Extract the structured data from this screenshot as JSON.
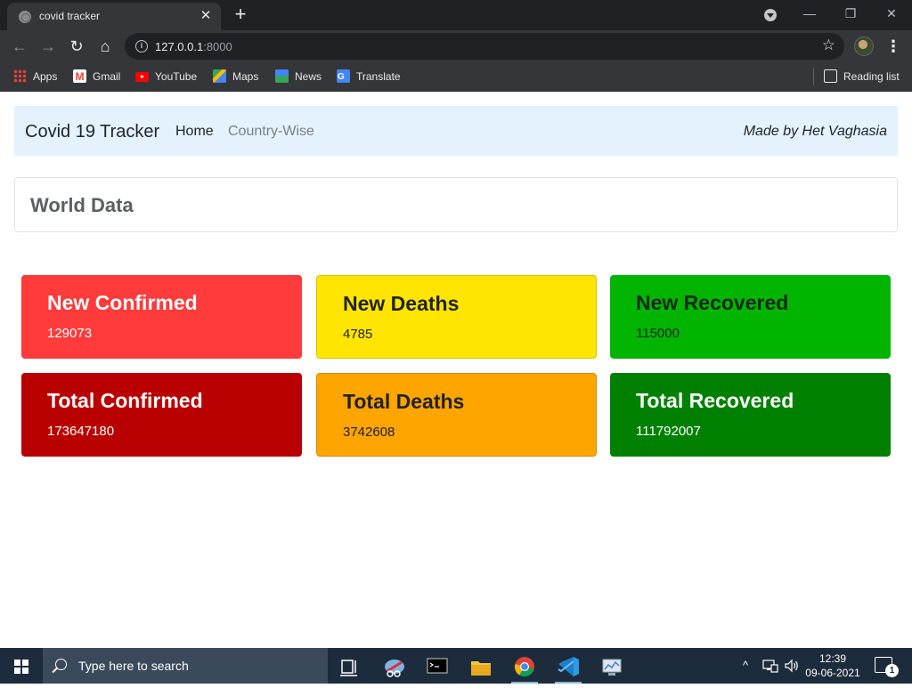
{
  "browser": {
    "tab_title": "covid tracker",
    "url_host": "127.0.0.1",
    "url_port": ":8000",
    "bookmarks": [
      {
        "label": "Apps",
        "icon": "apps-grid-icon"
      },
      {
        "label": "Gmail",
        "icon": "gmail-icon"
      },
      {
        "label": "YouTube",
        "icon": "youtube-icon"
      },
      {
        "label": "Maps",
        "icon": "maps-icon"
      },
      {
        "label": "News",
        "icon": "news-icon"
      },
      {
        "label": "Translate",
        "icon": "translate-icon"
      }
    ],
    "reading_list": "Reading list"
  },
  "navbar": {
    "brand": "Covid 19 Tracker",
    "links": [
      {
        "label": "Home",
        "active": true
      },
      {
        "label": "Country-Wise",
        "active": false
      }
    ],
    "credit": "Made by Het Vaghasia"
  },
  "world": {
    "heading": "World Data",
    "stats": [
      {
        "title": "New Confirmed",
        "value": "129073",
        "color": "#ff3b3b"
      },
      {
        "title": "New Deaths",
        "value": "4785",
        "color": "#ffe500"
      },
      {
        "title": "New Recovered",
        "value": "115000",
        "color": "#00b400"
      },
      {
        "title": "Total Confirmed",
        "value": "173647180",
        "color": "#b90000"
      },
      {
        "title": "Total Deaths",
        "value": "3742608",
        "color": "#ffa500"
      },
      {
        "title": "Total Recovered",
        "value": "111792007",
        "color": "#008000"
      }
    ]
  },
  "taskbar": {
    "search_placeholder": "Type here to search",
    "time": "12:39",
    "date": "09-06-2021",
    "notification_count": "1"
  }
}
